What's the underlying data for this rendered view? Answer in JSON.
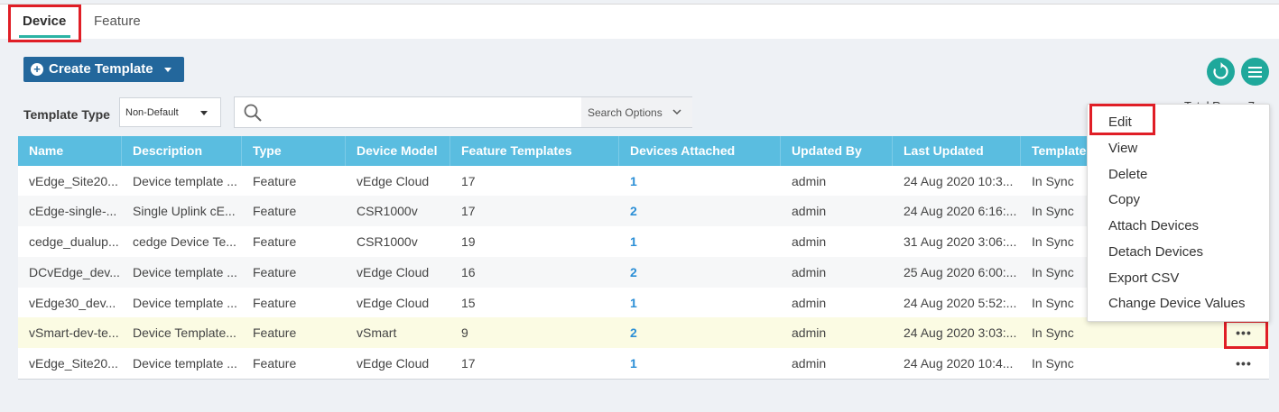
{
  "tabs": [
    {
      "label": "Device",
      "active": true
    },
    {
      "label": "Feature",
      "active": false
    }
  ],
  "toolbar": {
    "create_template_label": "Create Template",
    "template_type_label": "Template Type",
    "template_type_value": "Non-Default",
    "search_placeholder": "",
    "search_options_label": "Search Options",
    "total_rows_label": "Total Rows: 7"
  },
  "icons": {
    "create": "plus-circle-icon",
    "refresh": "refresh-icon",
    "menu": "hamburger-menu-icon",
    "search": "search-icon",
    "more": "more-horizontal-icon"
  },
  "colors": {
    "accent": "#1fa89b",
    "header": "#5abde0",
    "primary_button": "#23679c",
    "link": "#2c8fd6",
    "highlight": "#e01e26"
  },
  "table": {
    "columns": [
      "Name",
      "Description",
      "Type",
      "Device Model",
      "Feature Templates",
      "Devices Attached",
      "Updated By",
      "Last Updated",
      "Template Status"
    ],
    "rows": [
      [
        "vEdge_Site20...",
        "Device template ...",
        "Feature",
        "vEdge Cloud",
        "17",
        "1",
        "admin",
        "24 Aug 2020 10:3...",
        "In Sync"
      ],
      [
        "cEdge-single-...",
        "Single Uplink cE...",
        "Feature",
        "CSR1000v",
        "17",
        "2",
        "admin",
        "24 Aug 2020 6:16:...",
        "In Sync"
      ],
      [
        "cedge_dualup...",
        "cedge Device Te...",
        "Feature",
        "CSR1000v",
        "19",
        "1",
        "admin",
        "31 Aug 2020 3:06:...",
        "In Sync"
      ],
      [
        "DCvEdge_dev...",
        "Device template ...",
        "Feature",
        "vEdge Cloud",
        "16",
        "2",
        "admin",
        "25 Aug 2020 6:00:...",
        "In Sync"
      ],
      [
        "vEdge30_dev...",
        "Device template ...",
        "Feature",
        "vEdge Cloud",
        "15",
        "1",
        "admin",
        "24 Aug 2020 5:52:...",
        "In Sync"
      ],
      [
        "vSmart-dev-te...",
        "Device Template...",
        "Feature",
        "vSmart",
        "9",
        "2",
        "admin",
        "24 Aug 2020 3:03:...",
        "In Sync"
      ],
      [
        "vEdge_Site20...",
        "Device template ...",
        "Feature",
        "vEdge Cloud",
        "17",
        "1",
        "admin",
        "24 Aug 2020 10:4...",
        "In Sync"
      ]
    ],
    "more_label": "•••"
  },
  "context_menu": {
    "items": [
      "Edit",
      "View",
      "Delete",
      "Copy",
      "Attach Devices",
      "Detach Devices",
      "Export CSV",
      "Change Device Values"
    ]
  }
}
